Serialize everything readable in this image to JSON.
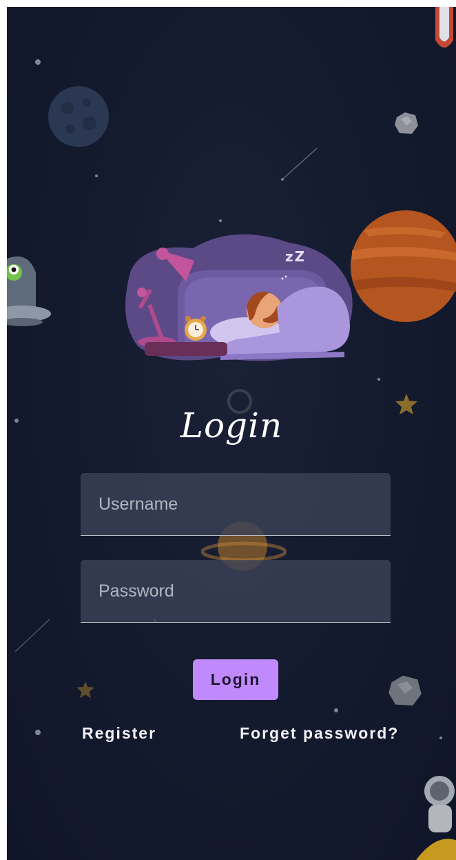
{
  "login": {
    "title": "Login",
    "username_placeholder": "Username",
    "password_placeholder": "Password",
    "button_label": "Login",
    "register_label": "Register",
    "forgot_label": "Forget password?"
  },
  "illustration": {
    "sleep_text": "zZ"
  },
  "colors": {
    "background": "#141a2d",
    "button": "#c08afc",
    "field": "#3c4258",
    "text": "#ffffff"
  },
  "icons": [
    "sleeping-man-illustration",
    "moon-icon",
    "planet-icon",
    "asteroid-icon",
    "star-icon",
    "rocket-icon",
    "alien-ufo-icon",
    "astronaut-icon"
  ]
}
